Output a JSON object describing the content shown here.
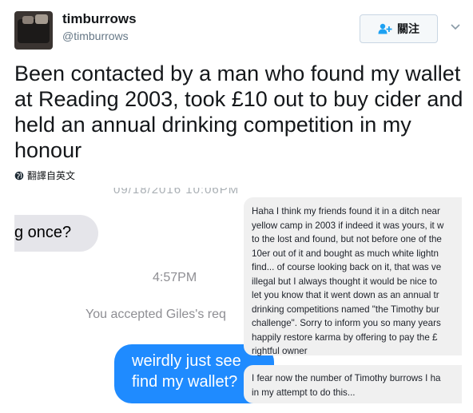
{
  "tweet": {
    "display_name": "timburrows",
    "handle": "@timburrows",
    "follow_label": "關注",
    "text": "Been contacted by a man who found my wallet at Reading 2003, took £10 out to buy cider and held an annual drinking competition in my honour",
    "translate_label": "翻譯自英文"
  },
  "screenshot": {
    "timestamp_top": "09/18/2016 10:06PM",
    "gray_bubble": "g once?",
    "time_mid": "4:57PM",
    "accepted": "You accepted Giles's req",
    "blue_bubble_line1": "weirdly just see",
    "blue_bubble_line2": "find my wallet?",
    "message_lines": [
      "Haha I think my friends found it in a ditch near",
      "yellow camp in 2003 if indeed it was yours, it w",
      "to the lost and found, but not before one of the",
      "10er out of it and bought as much white lightn",
      "find... of course looking back on it, that was ve",
      "illegal but I always thought it would be nice to",
      "let you know that it went down as an annual tr",
      "drinking competitions named \"the Timothy bur",
      "challenge\". Sorry to inform you so many years",
      "happily restore karma by offering to pay the £",
      "rightful owner"
    ],
    "message2_lines": [
      "I fear now the number of Timothy burrows I ha",
      "in my attempt to do this..."
    ]
  },
  "icons": {
    "follow": "person-plus-icon",
    "caret": "chevron-down-icon",
    "globe": "globe-icon"
  },
  "colors": {
    "accent_blue": "#1f8bff",
    "follow_icon": "#1da1f2"
  }
}
